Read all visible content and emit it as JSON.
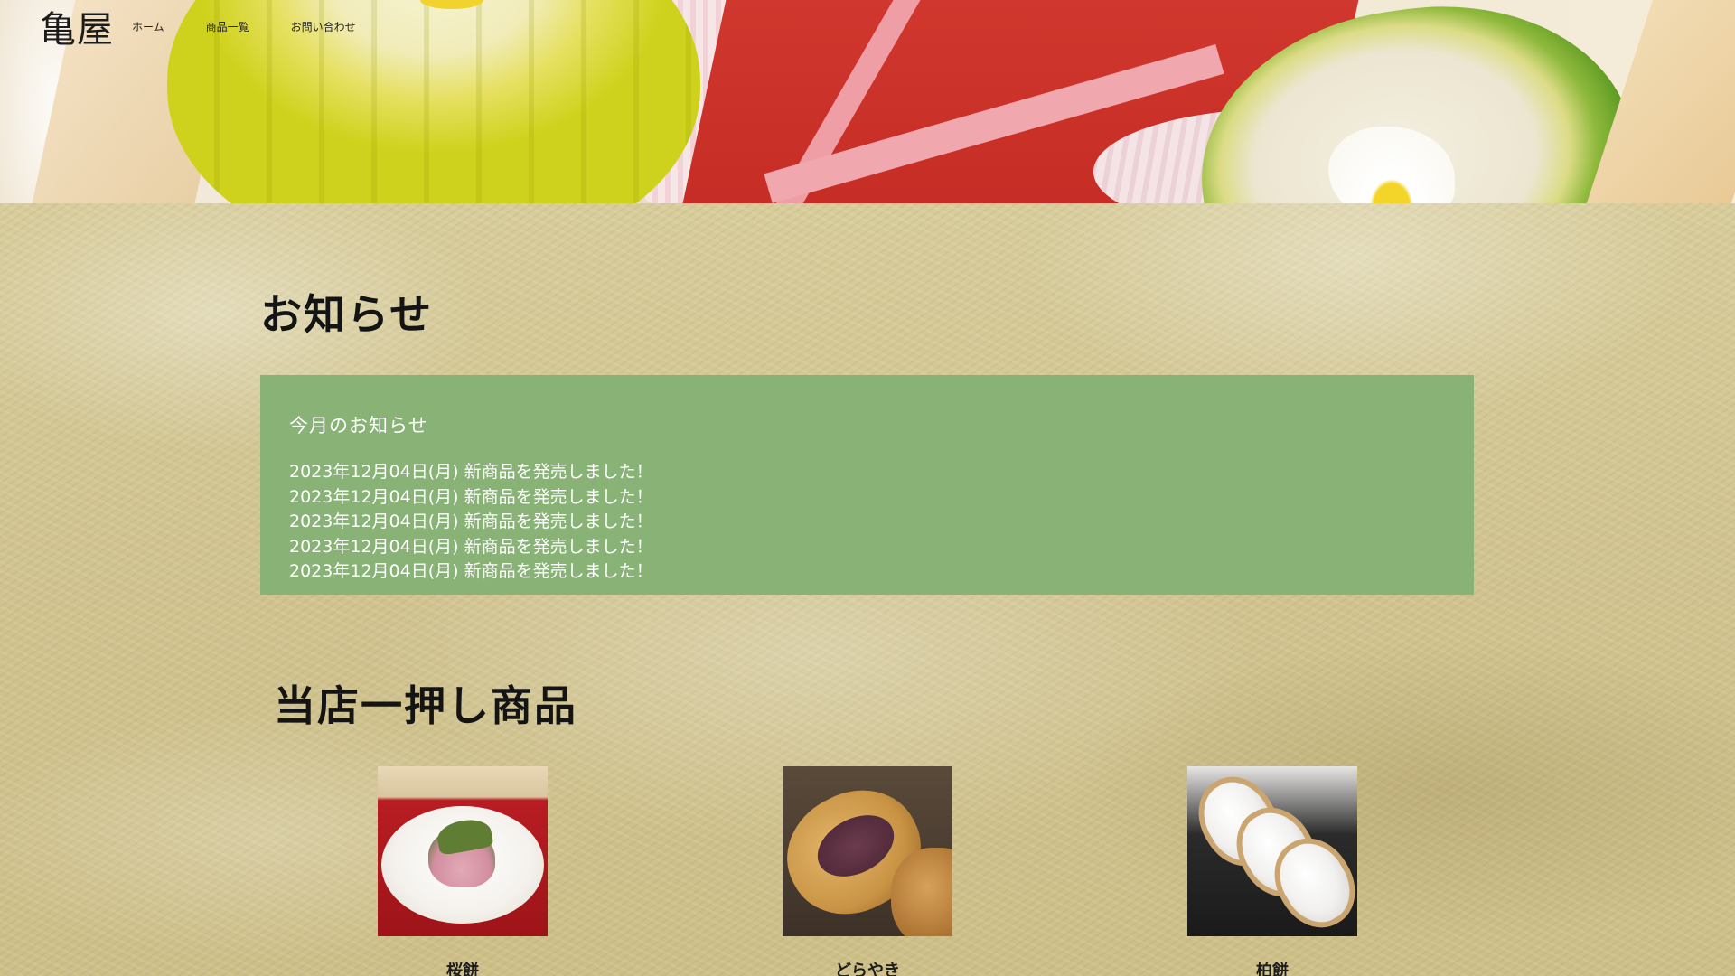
{
  "header": {
    "logo": "亀屋",
    "nav": [
      "ホーム",
      "商品一覧",
      "お問い合わせ"
    ]
  },
  "news": {
    "heading": "お知らせ",
    "box_title": "今月のお知らせ",
    "items": [
      "2023年12月04日(月) 新商品を発売しました！",
      "2023年12月04日(月) 新商品を発売しました！",
      "2023年12月04日(月) 新商品を発売しました！",
      "2023年12月04日(月) 新商品を発売しました！",
      "2023年12月04日(月) 新商品を発売しました！"
    ]
  },
  "featured": {
    "heading": "当店一押し商品",
    "products": [
      {
        "name": "桜餅"
      },
      {
        "name": "どらやき"
      },
      {
        "name": "柏餅"
      }
    ]
  },
  "colors": {
    "news_box": "#89b277",
    "paper_bg": "#cdbf8a",
    "text_dark": "#141414"
  }
}
